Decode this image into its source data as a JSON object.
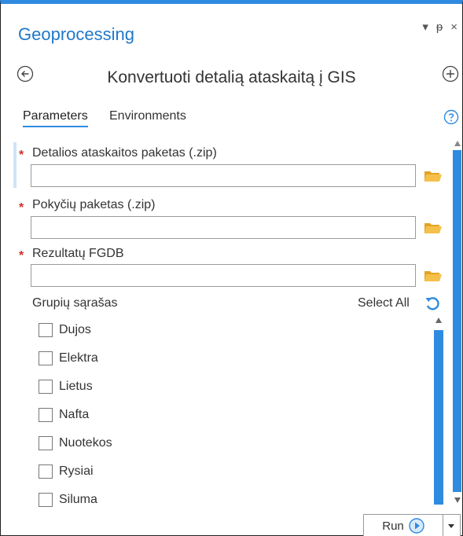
{
  "pane": {
    "title": "Geoprocessing",
    "controls": {
      "menu": "▾",
      "pin": "ᵽ",
      "close": "×"
    }
  },
  "tool": {
    "title": "Konvertuoti detalią ataskaitą į GIS",
    "back_icon": "back-circle-icon",
    "add_icon": "add-circle-icon"
  },
  "tabs": [
    {
      "label": "Parameters",
      "active": true
    },
    {
      "label": "Environments",
      "active": false
    }
  ],
  "help_icon": "help-icon",
  "parameters": [
    {
      "label": "Detalios ataskaitos paketas (.zip)",
      "required": true,
      "value": "",
      "placeholder": ""
    },
    {
      "label": "Pokyčių paketas (.zip)",
      "required": true,
      "value": "",
      "placeholder": ""
    },
    {
      "label": "Rezultatų FGDB",
      "required": true,
      "value": "",
      "placeholder": ""
    }
  ],
  "required_marker": "*",
  "groups": {
    "label": "Grupių sąrašas",
    "select_all": "Select All",
    "items": [
      {
        "label": "Dujos",
        "checked": false
      },
      {
        "label": "Elektra",
        "checked": false
      },
      {
        "label": "Lietus",
        "checked": false
      },
      {
        "label": "Nafta",
        "checked": false
      },
      {
        "label": "Nuotekos",
        "checked": false
      },
      {
        "label": "Rysiai",
        "checked": false
      },
      {
        "label": "Siluma",
        "checked": false
      }
    ]
  },
  "run": {
    "label": "Run"
  },
  "colors": {
    "accent": "#2f8be0",
    "title": "#1f78c8",
    "required": "#d0302d",
    "folder": "#f2b632"
  }
}
